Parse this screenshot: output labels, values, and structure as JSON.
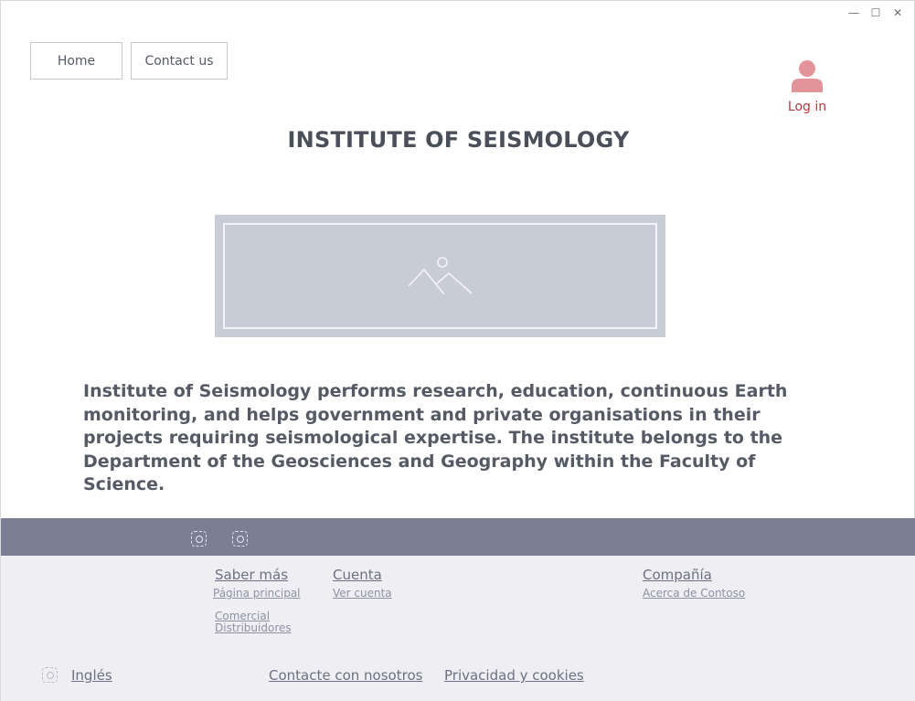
{
  "window": {
    "minimize_glyph": "—",
    "maximize_glyph": "☐",
    "close_glyph": "✕"
  },
  "nav": {
    "home_label": "Home",
    "contact_label": "Contact us"
  },
  "login": {
    "label": "Log in",
    "icon": "user-icon",
    "color": "#e3949b"
  },
  "page": {
    "title": "INSTITUTE OF SEISMOLOGY",
    "hero_icon": "image-placeholder-icon",
    "description": "Institute of Seismology performs research, education, continuous Earth monitoring, and helps government and private organisations in their projects requiring seismological expertise. The institute belongs to the Department of the Geosciences and Geography within the Faculty of Science."
  },
  "social": {
    "icons": [
      "social-icon-1",
      "social-icon-2"
    ],
    "bar_color": "#7a7f93"
  },
  "footer": {
    "columns": [
      {
        "heading": "Saber más",
        "links": [
          "Página principal",
          "Comercial",
          "Distribuidores"
        ]
      },
      {
        "heading": "Cuenta",
        "links": [
          "Ver cuenta"
        ]
      },
      {
        "heading": "Compañía",
        "links": [
          "Acerca de Contoso"
        ]
      }
    ],
    "language": "Inglés",
    "contact": "Contacte con nosotros",
    "privacy": "Privacidad y cookies",
    "background": "#efeff3"
  }
}
